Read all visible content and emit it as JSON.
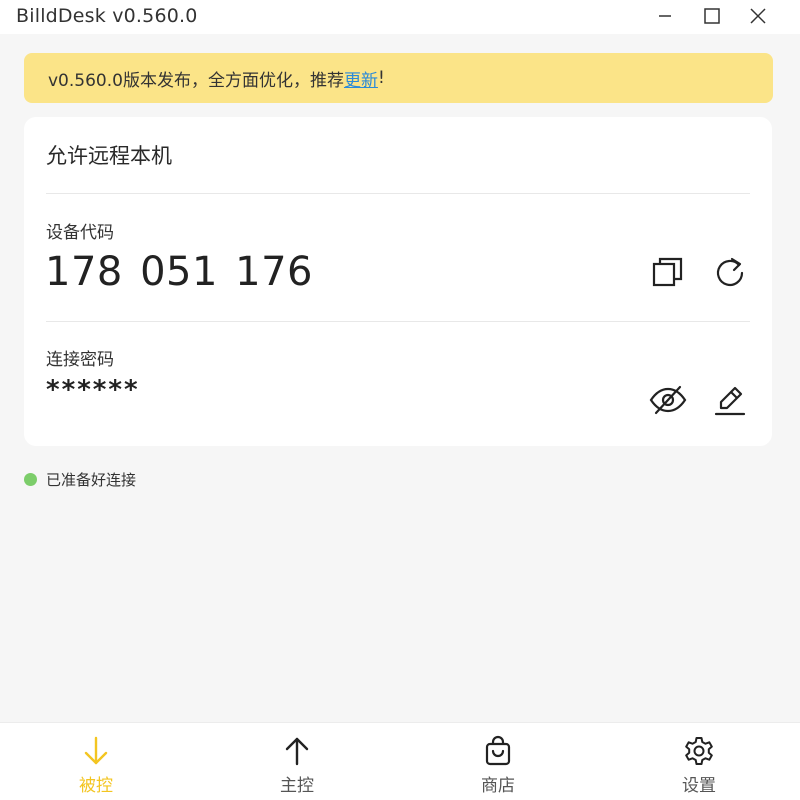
{
  "window": {
    "title": "BilldDesk v0.560.0"
  },
  "banner": {
    "text": "v0.560.0版本发布，全方面优化，推荐",
    "link_text": "更新",
    "suffix": "!"
  },
  "card": {
    "title": "允许远程本机",
    "device_code_label": "设备代码",
    "device_code": "178 051 176",
    "password_label": "连接密码",
    "password": "******"
  },
  "status": {
    "text": "已准备好连接",
    "color": "#7ccd6a"
  },
  "nav": {
    "items": [
      {
        "label": "被控",
        "icon": "arrow-down-icon",
        "active": true
      },
      {
        "label": "主控",
        "icon": "arrow-up-icon",
        "active": false
      },
      {
        "label": "商店",
        "icon": "shopping-bag-icon",
        "active": false
      },
      {
        "label": "设置",
        "icon": "gear-icon",
        "active": false
      }
    ]
  },
  "colors": {
    "accent": "#f3c521",
    "banner_bg": "#fbe488",
    "link": "#2a8ad8"
  }
}
